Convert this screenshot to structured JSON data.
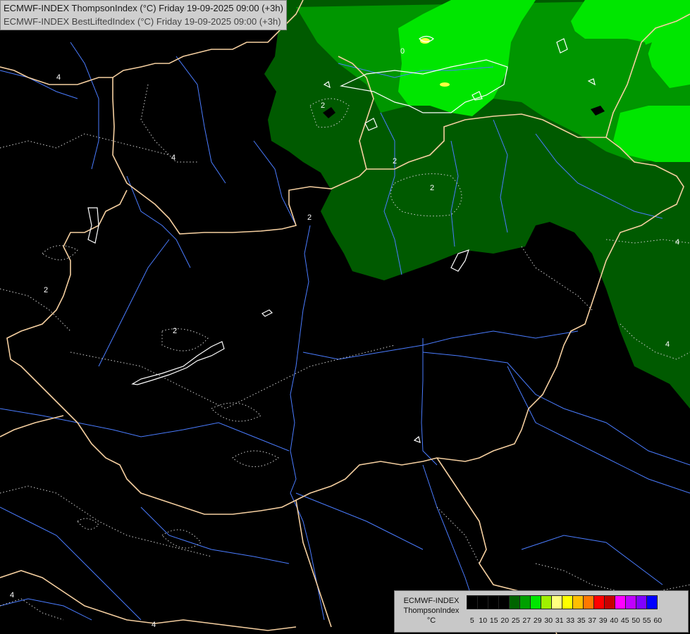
{
  "header": {
    "line1": "ECMWF-INDEX ThompsonIndex (°C) Friday 19-09-2025 09:00 (+3h)",
    "line2": "ECMWF-INDEX BestLiftedIndex (°C) Friday 19-09-2025 09:00 (+3h)"
  },
  "legend": {
    "label_line1": "ECMWF-INDEX",
    "label_line2": "ThompsonIndex",
    "label_line3": "°C",
    "classes": [
      {
        "value": "5",
        "color": "#000000"
      },
      {
        "value": "10",
        "color": "#000000"
      },
      {
        "value": "15",
        "color": "#000000"
      },
      {
        "value": "20",
        "color": "#000000"
      },
      {
        "value": "25",
        "color": "#006400"
      },
      {
        "value": "27",
        "color": "#00a000"
      },
      {
        "value": "29",
        "color": "#00e600"
      },
      {
        "value": "30",
        "color": "#a0f000"
      },
      {
        "value": "31",
        "color": "#ffff80"
      },
      {
        "value": "33",
        "color": "#ffff00"
      },
      {
        "value": "35",
        "color": "#ffbe00"
      },
      {
        "value": "37",
        "color": "#ff7800"
      },
      {
        "value": "39",
        "color": "#ff0000"
      },
      {
        "value": "40",
        "color": "#c80000"
      },
      {
        "value": "45",
        "color": "#ff00ff"
      },
      {
        "value": "50",
        "color": "#c000ff"
      },
      {
        "value": "55",
        "color": "#8000ff"
      },
      {
        "value": "60",
        "color": "#0000ff"
      }
    ]
  },
  "contour_labels": [
    "4",
    "2",
    "2",
    "2",
    "2",
    "2",
    "2",
    "4",
    "4",
    "4",
    "4",
    "4",
    "0"
  ],
  "colors": {
    "dark_green": "#005a00",
    "mid_green": "#009600",
    "bright_green": "#00e600",
    "border": "#f5cfa0",
    "river": "#4a7cff",
    "contour": "#ffffff",
    "hotspot": "#ffff40"
  }
}
